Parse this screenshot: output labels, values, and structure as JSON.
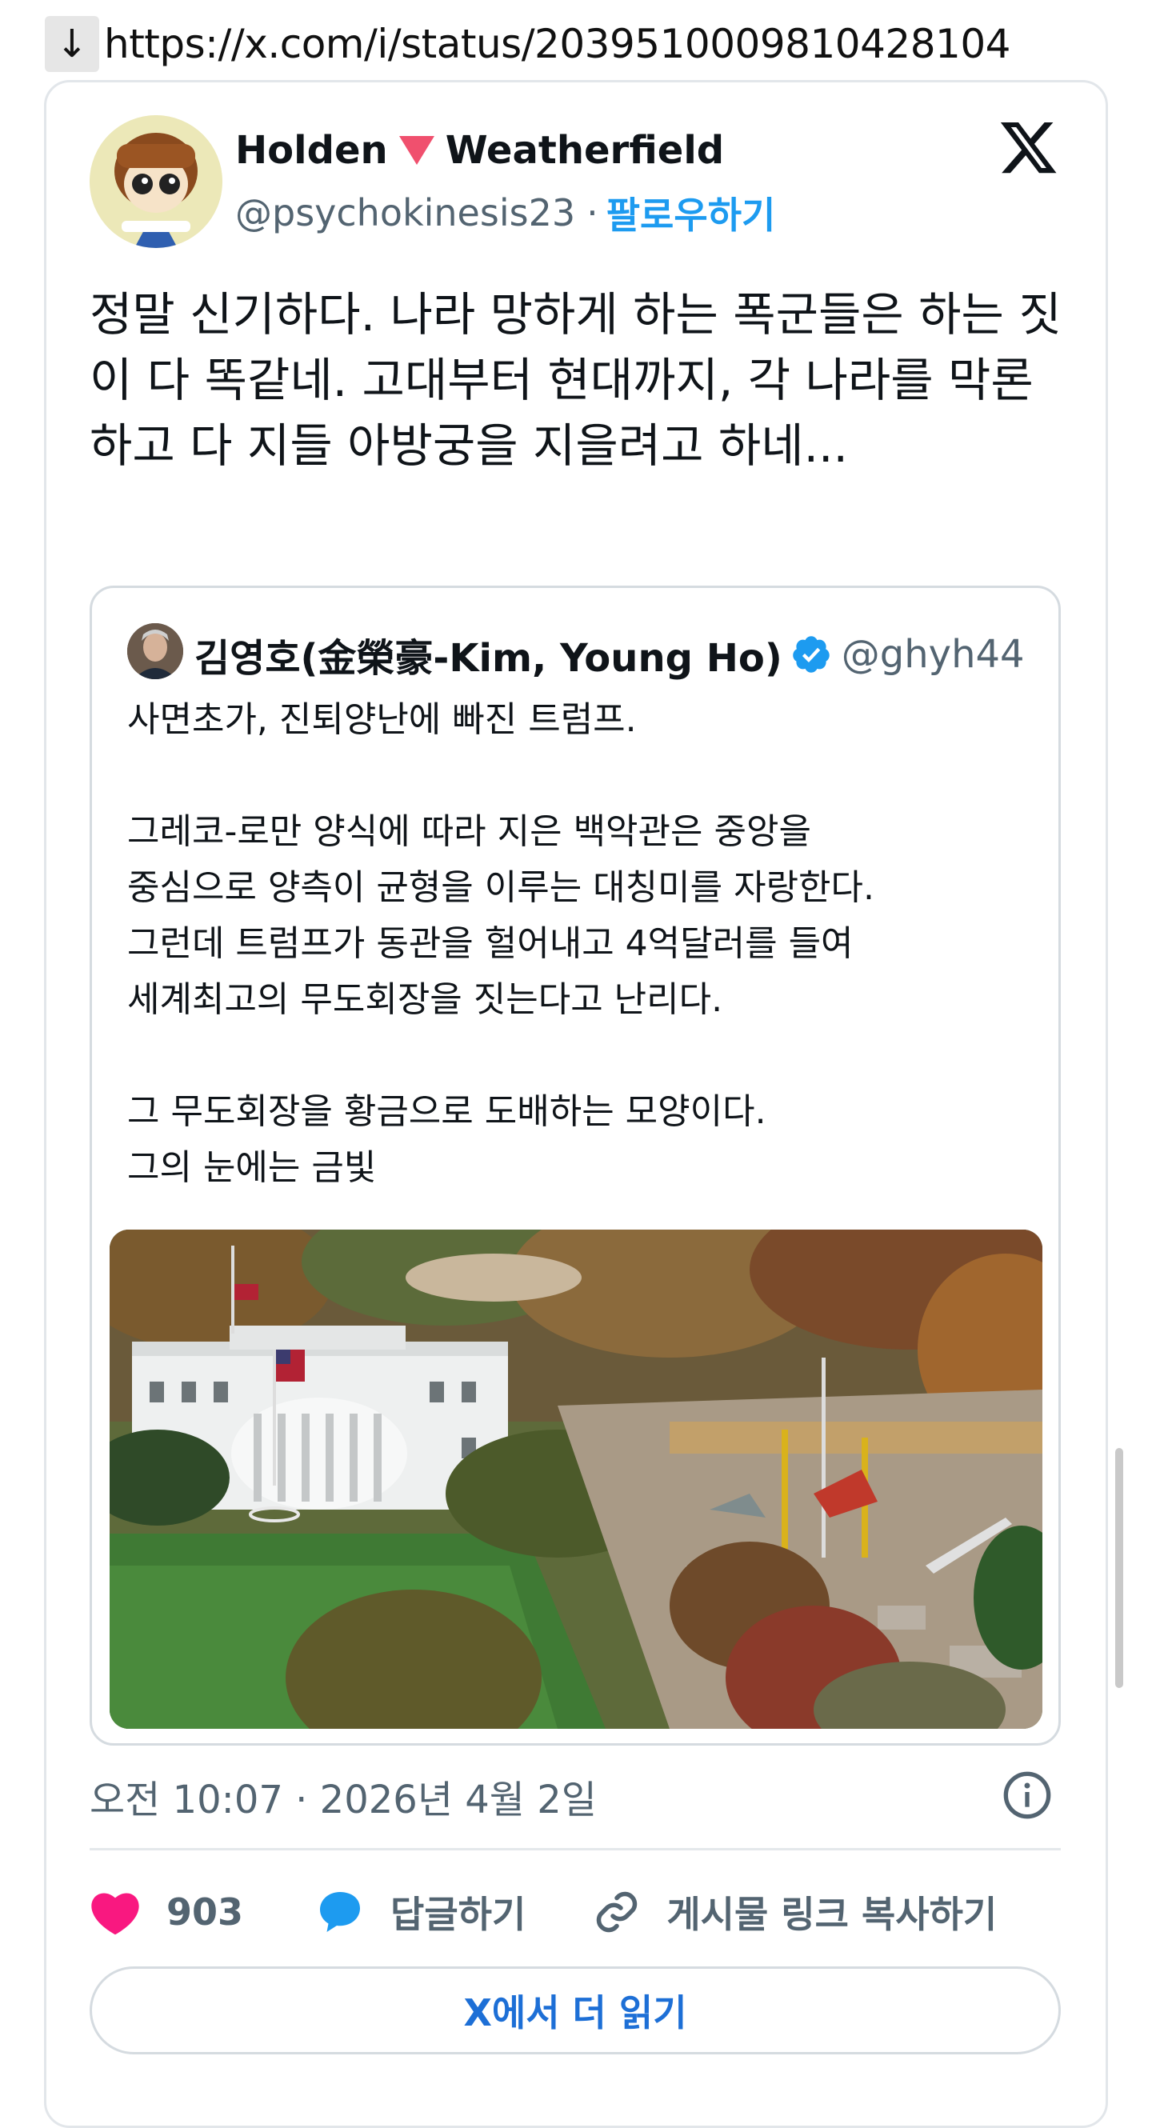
{
  "url_bar": {
    "arrow": "↓",
    "url": "https://x.com/i/status/2039510009810428104"
  },
  "tweet": {
    "author_name_first": "Holden",
    "author_name_last": "Weatherfield",
    "handle": "@psychokinesis23",
    "separator": "·",
    "follow_label": "팔로우하기",
    "text": "정말 신기하다. 나라 망하게 하는 폭군들은 하는 짓이 다 똑같네. 고대부터 현대까지, 각 나라를 막론하고 다 지들 아방궁을 지을려고 하네...",
    "timestamp": "오전 10:07 · 2026년 4월 2일"
  },
  "quote": {
    "name": "김영호(金榮豪-Kim, Young Ho)",
    "handle": "@ghyh44",
    "lines": [
      "사면초가, 진퇴양난에 빠진 트럼프.",
      "",
      "그레코-로만 양식에 따라 지은 백악관은 중앙을",
      "중심으로 양측이 균형을 이루는 대칭미를 자랑한다.",
      "그런데 트럼프가 동관을 헐어내고 4억달러를 들여",
      "세계최고의 무도회장을 짓는다고 난리다.",
      "",
      "그 무도회장을 황금으로 도배하는 모양이다.",
      "그의 눈에는 금빛"
    ]
  },
  "actions": {
    "like_count": "903",
    "reply_label": "답글하기",
    "copy_link_label": "게시물 링크 복사하기"
  },
  "read_more_label": "X에서 더 읽기",
  "colors": {
    "accent": "#1d9bf0",
    "like": "#f91880",
    "muted": "#536471",
    "read_more": "#1d6fd6"
  },
  "icons": [
    "down-arrow-icon",
    "x-logo-icon",
    "verified-badge-icon",
    "info-icon",
    "heart-icon",
    "reply-bubble-icon",
    "link-icon"
  ]
}
